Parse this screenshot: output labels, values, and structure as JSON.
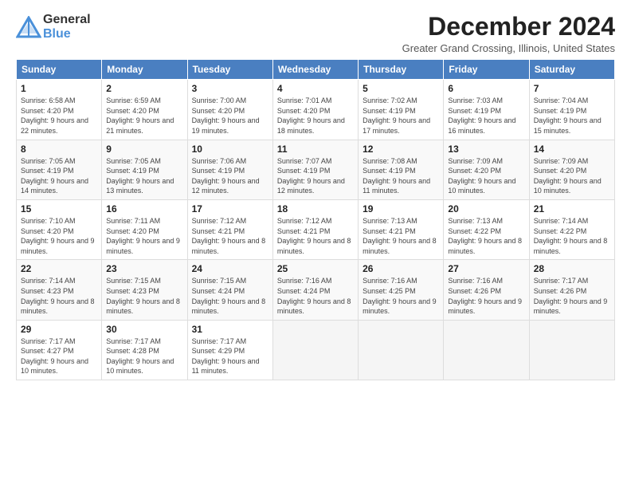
{
  "header": {
    "logo_line1": "General",
    "logo_line2": "Blue",
    "month_title": "December 2024",
    "location": "Greater Grand Crossing, Illinois, United States"
  },
  "days_of_week": [
    "Sunday",
    "Monday",
    "Tuesday",
    "Wednesday",
    "Thursday",
    "Friday",
    "Saturday"
  ],
  "weeks": [
    [
      {
        "day": "1",
        "sunrise": "6:58 AM",
        "sunset": "4:20 PM",
        "daylight": "9 hours and 22 minutes."
      },
      {
        "day": "2",
        "sunrise": "6:59 AM",
        "sunset": "4:20 PM",
        "daylight": "9 hours and 21 minutes."
      },
      {
        "day": "3",
        "sunrise": "7:00 AM",
        "sunset": "4:20 PM",
        "daylight": "9 hours and 19 minutes."
      },
      {
        "day": "4",
        "sunrise": "7:01 AM",
        "sunset": "4:20 PM",
        "daylight": "9 hours and 18 minutes."
      },
      {
        "day": "5",
        "sunrise": "7:02 AM",
        "sunset": "4:19 PM",
        "daylight": "9 hours and 17 minutes."
      },
      {
        "day": "6",
        "sunrise": "7:03 AM",
        "sunset": "4:19 PM",
        "daylight": "9 hours and 16 minutes."
      },
      {
        "day": "7",
        "sunrise": "7:04 AM",
        "sunset": "4:19 PM",
        "daylight": "9 hours and 15 minutes."
      }
    ],
    [
      {
        "day": "8",
        "sunrise": "7:05 AM",
        "sunset": "4:19 PM",
        "daylight": "9 hours and 14 minutes."
      },
      {
        "day": "9",
        "sunrise": "7:05 AM",
        "sunset": "4:19 PM",
        "daylight": "9 hours and 13 minutes."
      },
      {
        "day": "10",
        "sunrise": "7:06 AM",
        "sunset": "4:19 PM",
        "daylight": "9 hours and 12 minutes."
      },
      {
        "day": "11",
        "sunrise": "7:07 AM",
        "sunset": "4:19 PM",
        "daylight": "9 hours and 12 minutes."
      },
      {
        "day": "12",
        "sunrise": "7:08 AM",
        "sunset": "4:19 PM",
        "daylight": "9 hours and 11 minutes."
      },
      {
        "day": "13",
        "sunrise": "7:09 AM",
        "sunset": "4:20 PM",
        "daylight": "9 hours and 10 minutes."
      },
      {
        "day": "14",
        "sunrise": "7:09 AM",
        "sunset": "4:20 PM",
        "daylight": "9 hours and 10 minutes."
      }
    ],
    [
      {
        "day": "15",
        "sunrise": "7:10 AM",
        "sunset": "4:20 PM",
        "daylight": "9 hours and 9 minutes."
      },
      {
        "day": "16",
        "sunrise": "7:11 AM",
        "sunset": "4:20 PM",
        "daylight": "9 hours and 9 minutes."
      },
      {
        "day": "17",
        "sunrise": "7:12 AM",
        "sunset": "4:21 PM",
        "daylight": "9 hours and 8 minutes."
      },
      {
        "day": "18",
        "sunrise": "7:12 AM",
        "sunset": "4:21 PM",
        "daylight": "9 hours and 8 minutes."
      },
      {
        "day": "19",
        "sunrise": "7:13 AM",
        "sunset": "4:21 PM",
        "daylight": "9 hours and 8 minutes."
      },
      {
        "day": "20",
        "sunrise": "7:13 AM",
        "sunset": "4:22 PM",
        "daylight": "9 hours and 8 minutes."
      },
      {
        "day": "21",
        "sunrise": "7:14 AM",
        "sunset": "4:22 PM",
        "daylight": "9 hours and 8 minutes."
      }
    ],
    [
      {
        "day": "22",
        "sunrise": "7:14 AM",
        "sunset": "4:23 PM",
        "daylight": "9 hours and 8 minutes."
      },
      {
        "day": "23",
        "sunrise": "7:15 AM",
        "sunset": "4:23 PM",
        "daylight": "9 hours and 8 minutes."
      },
      {
        "day": "24",
        "sunrise": "7:15 AM",
        "sunset": "4:24 PM",
        "daylight": "9 hours and 8 minutes."
      },
      {
        "day": "25",
        "sunrise": "7:16 AM",
        "sunset": "4:24 PM",
        "daylight": "9 hours and 8 minutes."
      },
      {
        "day": "26",
        "sunrise": "7:16 AM",
        "sunset": "4:25 PM",
        "daylight": "9 hours and 9 minutes."
      },
      {
        "day": "27",
        "sunrise": "7:16 AM",
        "sunset": "4:26 PM",
        "daylight": "9 hours and 9 minutes."
      },
      {
        "day": "28",
        "sunrise": "7:17 AM",
        "sunset": "4:26 PM",
        "daylight": "9 hours and 9 minutes."
      }
    ],
    [
      {
        "day": "29",
        "sunrise": "7:17 AM",
        "sunset": "4:27 PM",
        "daylight": "9 hours and 10 minutes."
      },
      {
        "day": "30",
        "sunrise": "7:17 AM",
        "sunset": "4:28 PM",
        "daylight": "9 hours and 10 minutes."
      },
      {
        "day": "31",
        "sunrise": "7:17 AM",
        "sunset": "4:29 PM",
        "daylight": "9 hours and 11 minutes."
      },
      null,
      null,
      null,
      null
    ]
  ],
  "labels": {
    "sunrise_prefix": "Sunrise: ",
    "sunset_prefix": "Sunset: ",
    "daylight_prefix": "Daylight: "
  }
}
